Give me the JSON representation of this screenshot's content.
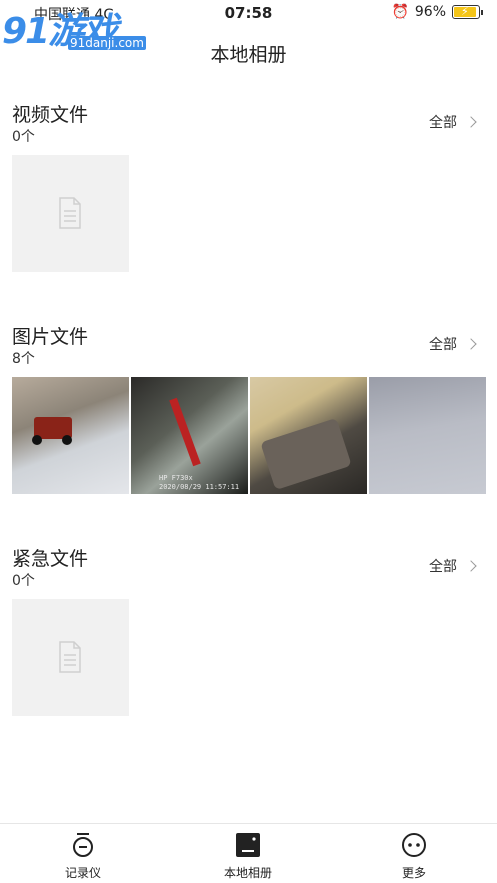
{
  "status_bar": {
    "carrier": "中国联通",
    "network": "4G",
    "time": "07:58",
    "battery": "96%"
  },
  "watermark": {
    "main": "91游戏",
    "sub": "91danji.com"
  },
  "header": {
    "title": "本地相册"
  },
  "sections": [
    {
      "title": "视频文件",
      "count": "0个",
      "all_label": "全部"
    },
    {
      "title": "图片文件",
      "count": "8个",
      "all_label": "全部",
      "thumb_caption_line1": "HP F730x",
      "thumb_caption_line2": "2020/08/29 11:57:11"
    },
    {
      "title": "紧急文件",
      "count": "0个",
      "all_label": "全部"
    }
  ],
  "tabs": [
    {
      "label": "记录仪",
      "icon": "dashcam-icon"
    },
    {
      "label": "本地相册",
      "icon": "album-icon"
    },
    {
      "label": "更多",
      "icon": "more-icon"
    }
  ],
  "colors": {
    "accent": "#3b8de8",
    "placeholder": "#f1f1f1",
    "battery": "#f5c518"
  }
}
